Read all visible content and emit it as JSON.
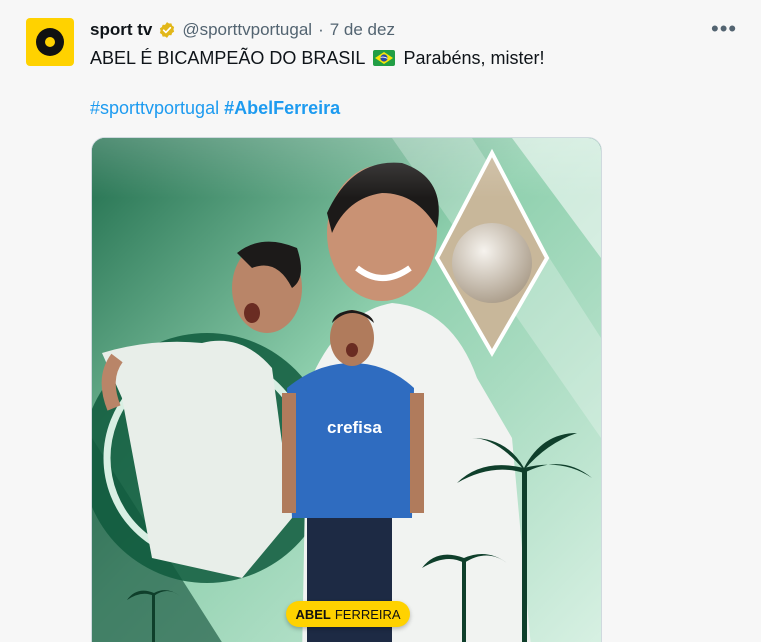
{
  "tweet": {
    "author_name": "sport tv",
    "author_handle": "@sporttvportugal",
    "separator": "·",
    "date": "7 de dez",
    "text_before_flag": "ABEL É BICAMPEÃO DO BRASIL",
    "text_after_flag": "Parabéns, mister!",
    "hashtag_1": "#sporttvportugal",
    "hashtag_2": "#AbelFerreira",
    "more_label": "•••",
    "flag_icon": "brazil-flag-emoji",
    "verified_icon": "gold-verified-badge"
  },
  "media": {
    "plate_first": "ABEL",
    "plate_last": "FERREIRA",
    "shirt_text": "crefisa"
  },
  "colors": {
    "link": "#1d9bf0",
    "brand_yellow": "#ffd200",
    "verified_gold": "#e2b719",
    "muted": "#536471"
  }
}
